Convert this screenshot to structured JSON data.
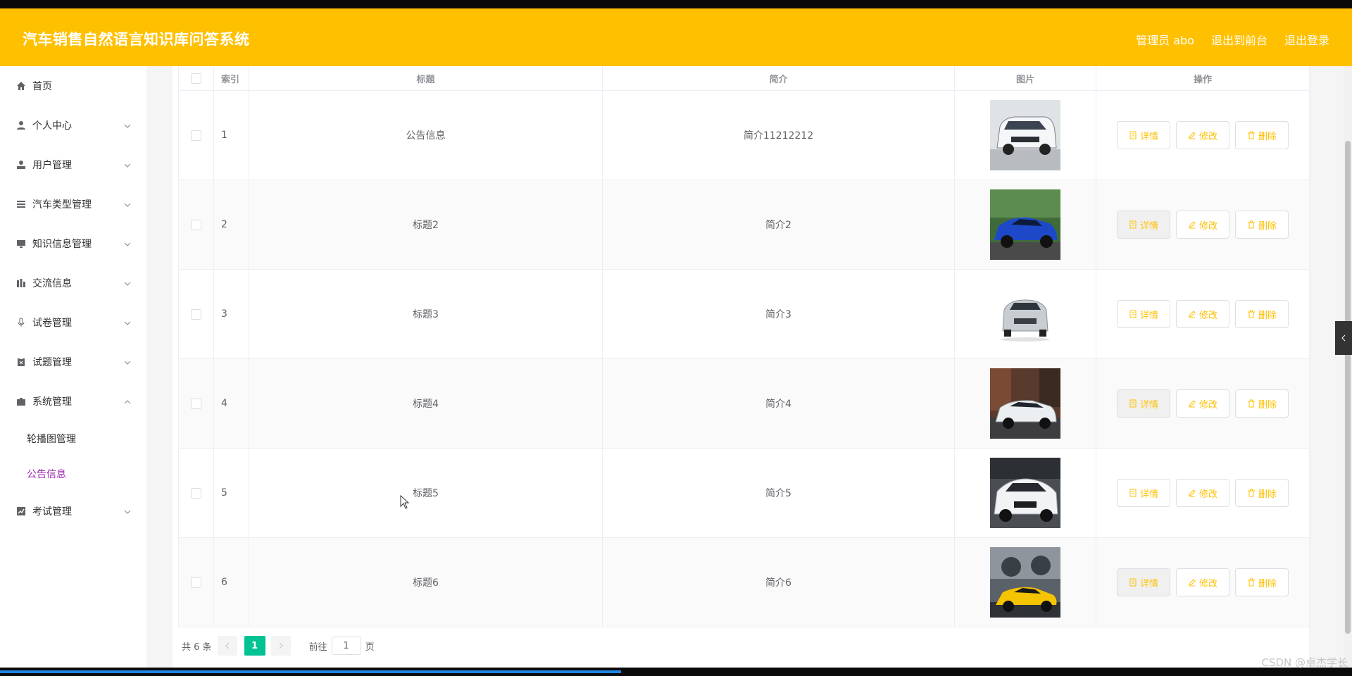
{
  "header": {
    "title": "汽车销售自然语言知识库问答系统",
    "admin_label": "管理员 abo",
    "front_label": "退出到前台",
    "logout_label": "退出登录"
  },
  "sidebar": {
    "items": [
      {
        "label": "首页",
        "icon": "home-icon"
      },
      {
        "label": "个人中心",
        "icon": "user-icon"
      },
      {
        "label": "用户管理",
        "icon": "user-manage-icon"
      },
      {
        "label": "汽车类型管理",
        "icon": "list-icon"
      },
      {
        "label": "知识信息管理",
        "icon": "monitor-icon"
      },
      {
        "label": "交流信息",
        "icon": "chart-bar-icon"
      },
      {
        "label": "试卷管理",
        "icon": "microphone-icon"
      },
      {
        "label": "试题管理",
        "icon": "clipboard-icon"
      },
      {
        "label": "系统管理",
        "icon": "briefcase-icon"
      },
      {
        "label": "考试管理",
        "icon": "line-chart-icon"
      }
    ],
    "system_sub": [
      {
        "label": "轮播图管理"
      },
      {
        "label": "公告信息"
      }
    ]
  },
  "table": {
    "headers": {
      "index": "索引",
      "title": "标题",
      "intro": "简介",
      "image": "图片",
      "ops": "操作"
    },
    "rows": [
      {
        "index": "1",
        "title": "公告信息",
        "intro": "简介11212212",
        "image": "white-van"
      },
      {
        "index": "2",
        "title": "标题2",
        "intro": "简介2",
        "image": "blue-sports-car"
      },
      {
        "index": "3",
        "title": "标题3",
        "intro": "简介3",
        "image": "silver-suv"
      },
      {
        "index": "4",
        "title": "标题4",
        "intro": "简介4",
        "image": "white-sedan-street"
      },
      {
        "index": "5",
        "title": "标题5",
        "intro": "简介5",
        "image": "white-hatchback"
      },
      {
        "index": "6",
        "title": "标题6",
        "intro": "简介6",
        "image": "yellow-supercar"
      }
    ],
    "actions": {
      "detail": "详情",
      "edit": "修改",
      "delete": "删除"
    }
  },
  "pagination": {
    "total_text": "共 6 条",
    "current_page": "1",
    "goto_label": "前往",
    "goto_value": "1",
    "page_suffix": "页"
  },
  "watermark": "CSDN @卓杰学长",
  "colors": {
    "header": "#ffc000",
    "accent": "#ffc000",
    "active_sub": "#9c27b0",
    "page_active": "#00c292"
  }
}
